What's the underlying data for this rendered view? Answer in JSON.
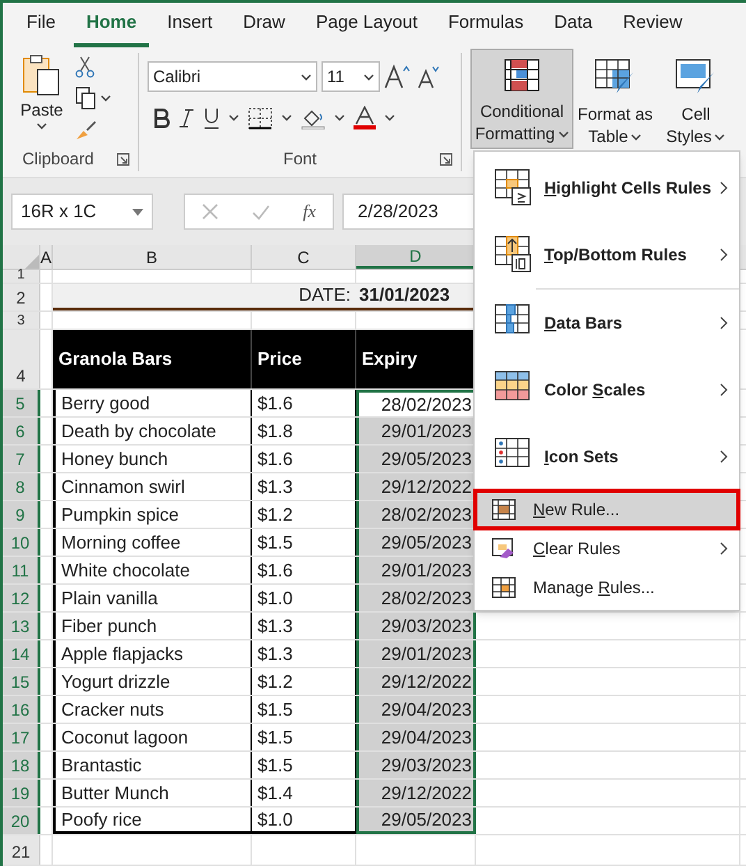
{
  "tabs": [
    {
      "label": "File",
      "selected": false
    },
    {
      "label": "Home",
      "selected": true
    },
    {
      "label": "Insert",
      "selected": false
    },
    {
      "label": "Draw",
      "selected": false
    },
    {
      "label": "Page Layout",
      "selected": false
    },
    {
      "label": "Formulas",
      "selected": false
    },
    {
      "label": "Data",
      "selected": false
    },
    {
      "label": "Review",
      "selected": false
    }
  ],
  "clipboard": {
    "paste": "Paste",
    "group": "Clipboard"
  },
  "font": {
    "name": "Calibri",
    "size": "11",
    "group": "Font"
  },
  "styles": [
    {
      "lines": [
        "Conditional",
        "Formatting"
      ],
      "pressed": true,
      "kind": "conditional"
    },
    {
      "lines": [
        "Format as",
        "Table"
      ],
      "pressed": false,
      "kind": "table"
    },
    {
      "lines": [
        "Cell",
        "Styles"
      ],
      "pressed": false,
      "kind": "cell"
    }
  ],
  "formula_bar": {
    "name_box": "16R x 1C",
    "fx": "fx",
    "value": "2/28/2023"
  },
  "columns": [
    {
      "label": "A",
      "selected": false
    },
    {
      "label": "B",
      "selected": false
    },
    {
      "label": "C",
      "selected": false
    },
    {
      "label": "D",
      "selected": true
    }
  ],
  "row_numbers": [
    {
      "label": "1",
      "selected": false
    },
    {
      "label": "2",
      "selected": false
    },
    {
      "label": "3",
      "selected": false
    },
    {
      "label": "4",
      "selected": false
    },
    {
      "label": "5",
      "selected": true
    },
    {
      "label": "6",
      "selected": true
    },
    {
      "label": "7",
      "selected": true
    },
    {
      "label": "8",
      "selected": true
    },
    {
      "label": "9",
      "selected": true
    },
    {
      "label": "10",
      "selected": true
    },
    {
      "label": "11",
      "selected": true
    },
    {
      "label": "12",
      "selected": true
    },
    {
      "label": "13",
      "selected": true
    },
    {
      "label": "14",
      "selected": true
    },
    {
      "label": "15",
      "selected": true
    },
    {
      "label": "16",
      "selected": true
    },
    {
      "label": "17",
      "selected": true
    },
    {
      "label": "18",
      "selected": true
    },
    {
      "label": "19",
      "selected": true
    },
    {
      "label": "20",
      "selected": true
    },
    {
      "label": "21",
      "selected": false
    }
  ],
  "sheet": {
    "date_label": "DATE:",
    "date_value": "31/01/2023",
    "headers": [
      "Granola Bars",
      "Price",
      "Expiry"
    ],
    "rows": [
      {
        "name": "Berry good",
        "price": "$1.6",
        "expiry": "28/02/2023",
        "active": true
      },
      {
        "name": "Death by chocolate",
        "price": "$1.8",
        "expiry": "29/01/2023",
        "active": false
      },
      {
        "name": "Honey bunch",
        "price": "$1.6",
        "expiry": "29/05/2023",
        "active": false
      },
      {
        "name": "Cinnamon swirl",
        "price": "$1.3",
        "expiry": "29/12/2022",
        "active": false
      },
      {
        "name": "Pumpkin spice",
        "price": "$1.2",
        "expiry": "28/02/2023",
        "active": false
      },
      {
        "name": "Morning coffee",
        "price": "$1.5",
        "expiry": "29/05/2023",
        "active": false
      },
      {
        "name": "White chocolate",
        "price": "$1.6",
        "expiry": "29/01/2023",
        "active": false
      },
      {
        "name": "Plain vanilla",
        "price": "$1.0",
        "expiry": "28/02/2023",
        "active": false
      },
      {
        "name": "Fiber punch",
        "price": "$1.3",
        "expiry": "29/03/2023",
        "active": false
      },
      {
        "name": "Apple flapjacks",
        "price": "$1.3",
        "expiry": "29/01/2023",
        "active": false
      },
      {
        "name": "Yogurt drizzle",
        "price": "$1.2",
        "expiry": "29/12/2022",
        "active": false
      },
      {
        "name": "Cracker nuts",
        "price": "$1.5",
        "expiry": "29/04/2023",
        "active": false
      },
      {
        "name": "Coconut lagoon",
        "price": "$1.5",
        "expiry": "29/04/2023",
        "active": false
      },
      {
        "name": "Brantastic",
        "price": "$1.5",
        "expiry": "29/03/2023",
        "active": false
      },
      {
        "name": "Butter Munch",
        "price": "$1.4",
        "expiry": "29/12/2022",
        "active": false
      },
      {
        "name": "Poofy rice",
        "price": "$1.0",
        "expiry": "29/05/2023",
        "active": false
      }
    ]
  },
  "menu": [
    {
      "key": "H",
      "after": "ighlight Cells Rules",
      "kind": "highlight",
      "submenu": true,
      "highlighted": false,
      "separator_after": false
    },
    {
      "key": "T",
      "after": "op/Bottom Rules",
      "kind": "top-bottom",
      "submenu": true,
      "highlighted": false,
      "separator_after": true
    },
    {
      "key": "D",
      "after": "ata Bars",
      "kind": "data-bars",
      "submenu": true,
      "highlighted": false,
      "separator_after": false
    },
    {
      "before": "Color ",
      "key": "S",
      "after": "cales",
      "kind": "color-scales",
      "submenu": true,
      "highlighted": false,
      "separator_after": false
    },
    {
      "key": "I",
      "after": "con Sets",
      "kind": "icon-sets",
      "submenu": true,
      "highlighted": false,
      "separator_after": false
    },
    {
      "key": "N",
      "after": "ew Rule...",
      "kind": "new-rule",
      "submenu": false,
      "highlighted": true,
      "separator_after": false
    },
    {
      "key": "C",
      "after": "lear Rules",
      "kind": "clear-rules",
      "submenu": true,
      "highlighted": false,
      "separator_after": false
    },
    {
      "before": "Manage ",
      "key": "R",
      "after": "ules...",
      "kind": "manage-rules",
      "submenu": false,
      "highlighted": false,
      "separator_after": false
    }
  ]
}
